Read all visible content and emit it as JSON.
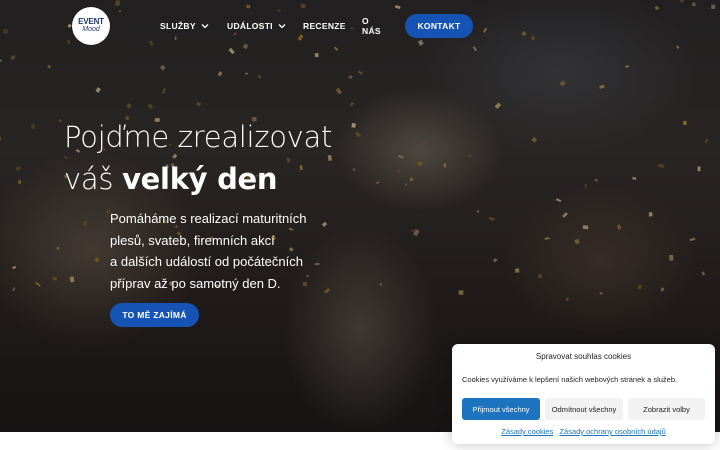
{
  "header": {
    "logo": {
      "top": "EVENT",
      "bottom": "Mood"
    },
    "nav": [
      {
        "label": "SLUŽBY",
        "dropdown": true
      },
      {
        "label": "UDÁLOSTI",
        "dropdown": true
      },
      {
        "label": "RECENZE",
        "dropdown": false
      },
      {
        "label": "O NÁS",
        "dropdown": false
      }
    ],
    "cta": "KONTAKT"
  },
  "hero": {
    "headline_line1": "Pojďme zrealizovat",
    "headline_line2_regular": "váš",
    "headline_line2_bold": "velký den",
    "subtext": [
      "Pomáháme s realizací maturitních",
      "plesů, svateb, firemních akcí",
      "a dalších událostí od počátečních",
      "příprav až po samotný den D."
    ],
    "cta": "TO MĚ ZAJÍMÁ"
  },
  "cookie_banner": {
    "title": "Spravovat souhlas cookies",
    "text": "Cookies využíváme k lepšení našich webových stránek a služeb.",
    "buttons": {
      "accept_all": "Přijmout všechny",
      "reject_all": "Odmítnout všechny",
      "show_preferences": "Zobrazit volby"
    },
    "links": {
      "cookie_policy": "Zásady cookies",
      "privacy_policy": "Zásady ochrany osobních údajů"
    }
  },
  "colors": {
    "accent": "#1554b4",
    "cookie_primary": "#1e73be",
    "logo_text": "#1f3b6e"
  },
  "icons": {
    "nav_dropdown": "chevron-down-icon"
  }
}
